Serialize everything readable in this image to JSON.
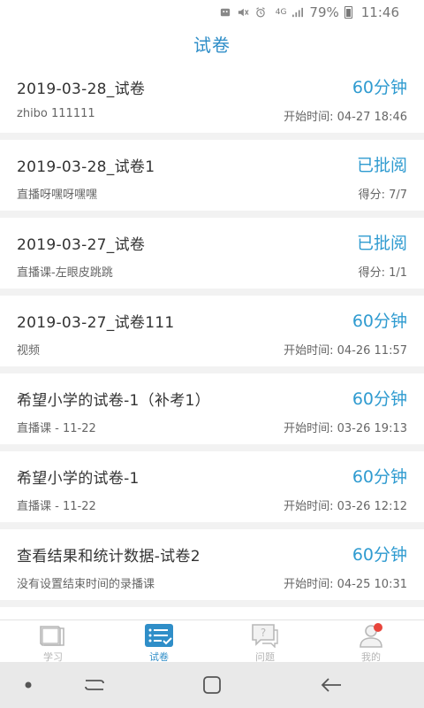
{
  "status_bar": {
    "battery": "79%",
    "time": "11:46",
    "network": "4G"
  },
  "header": {
    "title": "试卷"
  },
  "papers": [
    {
      "title": "2019-03-28_试卷",
      "status": "60分钟",
      "subtitle": "zhibo 111111",
      "meta": "开始时间: 04-27 18:46"
    },
    {
      "title": "2019-03-28_试卷1",
      "status": "已批阅",
      "subtitle": "直播呀嘿呀嘿嘿",
      "meta": "得分: 7/7"
    },
    {
      "title": "2019-03-27_试卷",
      "status": "已批阅",
      "subtitle": "直播课-左眼皮跳跳",
      "meta": "得分: 1/1"
    },
    {
      "title": "2019-03-27_试卷111",
      "status": "60分钟",
      "subtitle": "视频",
      "meta": "开始时间: 04-26 11:57"
    },
    {
      "title": "希望小学的试卷-1（补考1）",
      "status": "60分钟",
      "subtitle": "直播课 - 11-22",
      "meta": "开始时间: 03-26 19:13"
    },
    {
      "title": "希望小学的试卷-1",
      "status": "60分钟",
      "subtitle": "直播课 - 11-22",
      "meta": "开始时间: 03-26 12:12"
    },
    {
      "title": "查看结果和统计数据-试卷2",
      "status": "60分钟",
      "subtitle": "没有设置结束时间的录播课",
      "meta": "开始时间: 04-25 10:31"
    },
    {
      "title": "",
      "status": "",
      "subtitle": "",
      "meta": ""
    }
  ],
  "bottom_nav": [
    {
      "label": "学习",
      "icon": "book-icon",
      "active": false
    },
    {
      "label": "试卷",
      "icon": "list-icon",
      "active": true
    },
    {
      "label": "问题",
      "icon": "question-icon",
      "active": false
    },
    {
      "label": "我的",
      "icon": "profile-icon",
      "active": false
    }
  ],
  "colors": {
    "accent": "#2f8ec8",
    "status_blue": "#2f9bd0",
    "inactive": "#b5b5b5",
    "badge_red": "#e8453c"
  }
}
